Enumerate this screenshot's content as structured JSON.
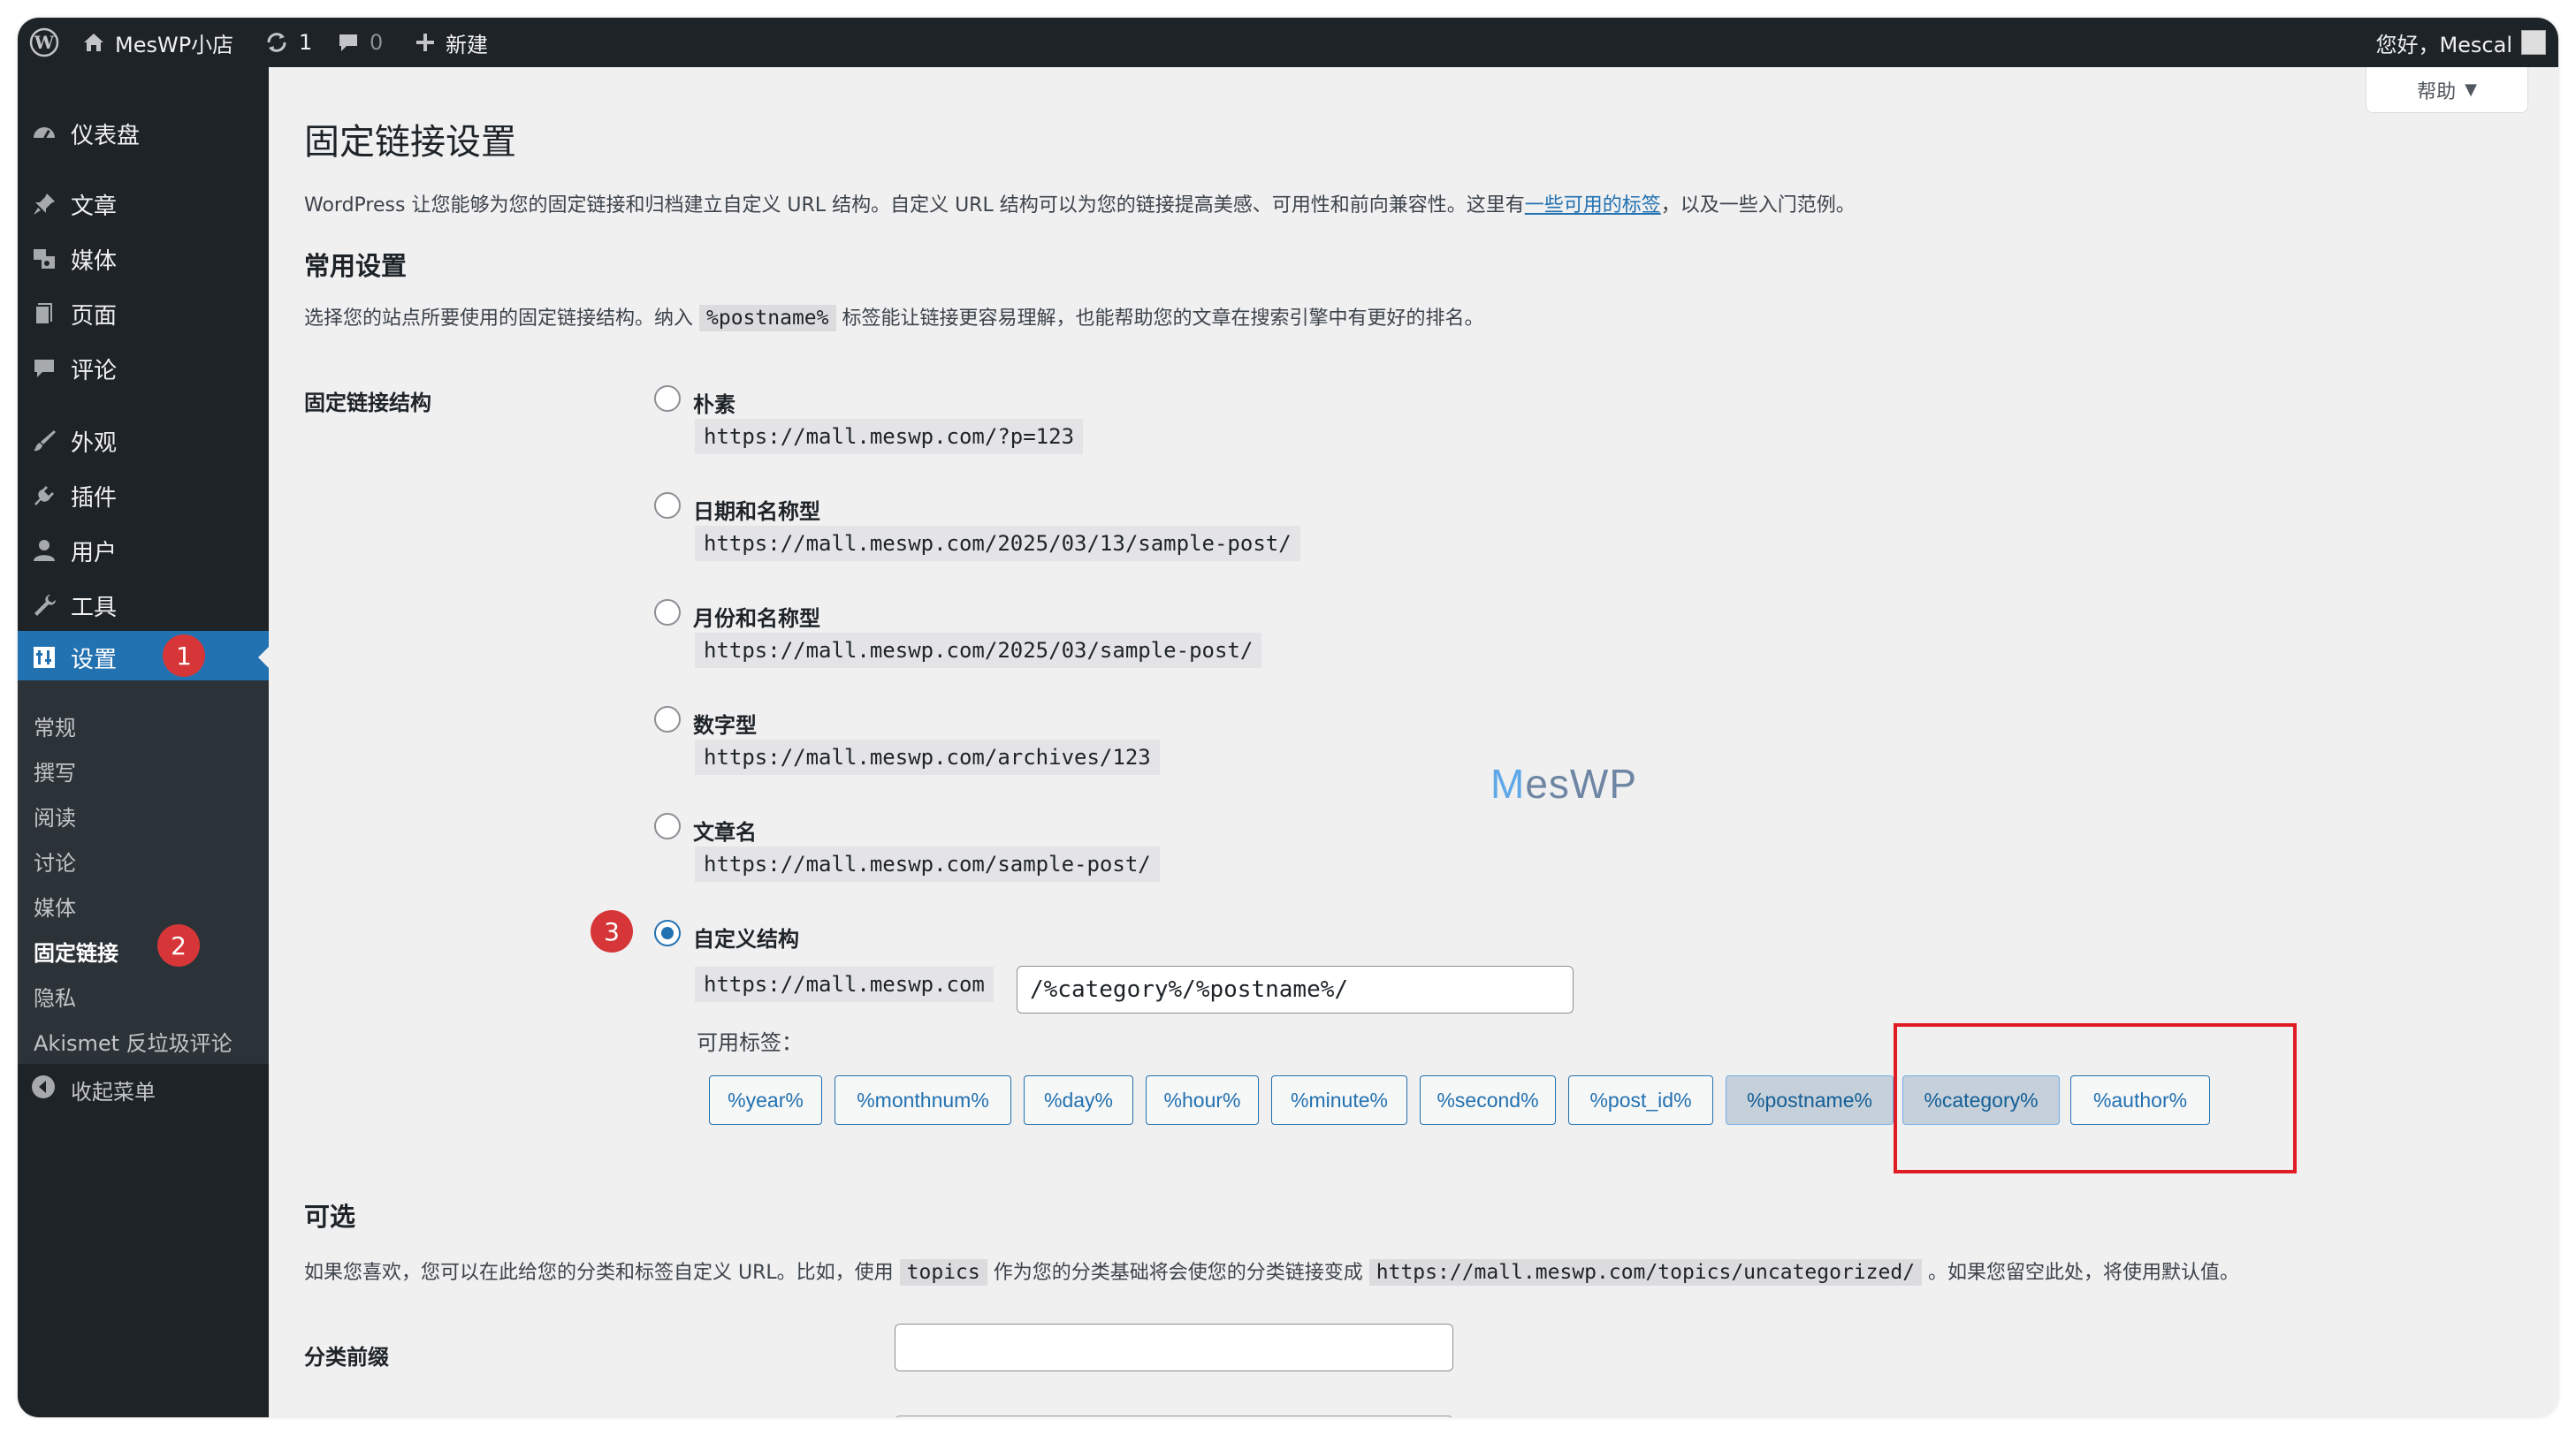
{
  "adminbar": {
    "site_name": "MesWP小店",
    "updates_count": "1",
    "comments_count": "0",
    "new_label": "新建",
    "greeting": "您好，Mescal"
  },
  "sidebar": {
    "items": [
      {
        "label": "仪表盘",
        "icon": "dashboard-icon"
      },
      {
        "label": "文章",
        "icon": "pin-icon"
      },
      {
        "label": "媒体",
        "icon": "media-icon"
      },
      {
        "label": "页面",
        "icon": "page-icon"
      },
      {
        "label": "评论",
        "icon": "comment-icon"
      },
      {
        "label": "外观",
        "icon": "brush-icon"
      },
      {
        "label": "插件",
        "icon": "plugin-icon"
      },
      {
        "label": "用户",
        "icon": "user-icon"
      },
      {
        "label": "工具",
        "icon": "wrench-icon"
      },
      {
        "label": "设置",
        "icon": "settings-icon"
      }
    ],
    "submenu": [
      "常规",
      "撰写",
      "阅读",
      "讨论",
      "媒体",
      "固定链接",
      "隐私",
      "Akismet 反垃圾评论"
    ],
    "collapse_label": "收起菜单",
    "step_badges": [
      "1",
      "2",
      "3"
    ]
  },
  "main": {
    "help_label": "帮助",
    "title": "固定链接设置",
    "intro_prefix": "WordPress 让您能够为您的固定链接和归档建立自定义 URL 结构。自定义 URL 结构可以为您的链接提高美感、可用性和前向兼容性。这里有",
    "intro_link": "一些可用的标签",
    "intro_suffix": "，以及一些入门范例。",
    "common_heading": "常用设置",
    "common_desc_prefix": "选择您的站点所要使用的固定链接结构。纳入",
    "common_desc_code": "%postname%",
    "common_desc_suffix": "标签能让链接更容易理解，也能帮助您的文章在搜索引擎中有更好的排名。",
    "structure_label": "固定链接结构",
    "options": [
      {
        "label": "朴素",
        "example": "https://mall.meswp.com/?p=123"
      },
      {
        "label": "日期和名称型",
        "example": "https://mall.meswp.com/2025/03/13/sample-post/"
      },
      {
        "label": "月份和名称型",
        "example": "https://mall.meswp.com/2025/03/sample-post/"
      },
      {
        "label": "数字型",
        "example": "https://mall.meswp.com/archives/123"
      },
      {
        "label": "文章名",
        "example": "https://mall.meswp.com/sample-post/"
      },
      {
        "label": "自定义结构",
        "example": "https://mall.meswp.com"
      }
    ],
    "custom_value": "/%category%/%postname%/",
    "available_tags_label": "可用标签：",
    "tags": [
      "%year%",
      "%monthnum%",
      "%day%",
      "%hour%",
      "%minute%",
      "%second%",
      "%post_id%",
      "%postname%",
      "%category%",
      "%author%"
    ],
    "optional_heading": "可选",
    "optional_desc_prefix": "如果您喜欢，您可以在此给您的分类和标签自定义 URL。比如，使用",
    "optional_desc_code1": "topics",
    "optional_desc_middle": "作为您的分类基础将会使您的分类链接变成",
    "optional_desc_code2": "https://mall.meswp.com/topics/uncategorized/",
    "optional_desc_suffix": "。如果您留空此处，将使用默认值。",
    "category_base_label": "分类前缀",
    "watermark_a": "M",
    "watermark_b": "esWP",
    "accent_color": "#2271b1",
    "highlight_color": "#e01b24"
  }
}
